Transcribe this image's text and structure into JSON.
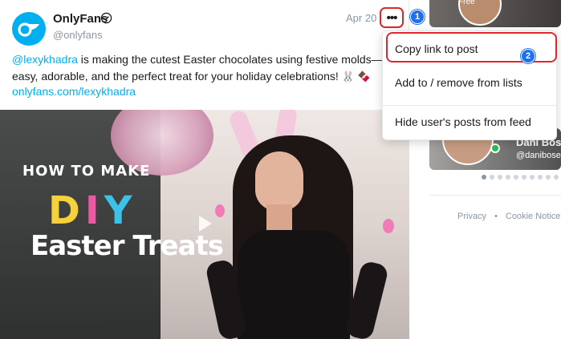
{
  "post": {
    "author_name": "OnlyFans",
    "handle": "@onlyfans",
    "date": "Apr 20",
    "more_label": "•••",
    "caption_mention": "@lexykhadra",
    "caption_text": " is making the cutest Easter chocolates using festive molds—easy, adorable, and the perfect treat for your holiday celebrations! ",
    "caption_emojis": "🐰 🍫",
    "link": "onlyfans.com/lexykhadra"
  },
  "media": {
    "title_line1": "HOW TO MAKE",
    "title_diy_d": "D",
    "title_diy_i": "I",
    "title_diy_y": "Y",
    "title_line3": "Easter Treats"
  },
  "annotations": {
    "step1": "1",
    "step2": "2"
  },
  "menu": {
    "items": [
      {
        "label": "Copy link to post"
      },
      {
        "label": "Add to / remove from lists"
      },
      {
        "label": "Hide user's posts from feed"
      }
    ]
  },
  "sidebar": {
    "card_top_badge": "Free",
    "card_bottom_name": "Dani Bos",
    "card_bottom_handle": "@danibose",
    "footer_privacy": "Privacy",
    "footer_sep": "•",
    "footer_cookie": "Cookie Notice"
  },
  "colors": {
    "brand": "#00aff0",
    "annotation_red": "#e0262b",
    "annotation_blue": "#1b6ff0",
    "online": "#27c24c"
  },
  "icons": [
    "onlyfans-logo-icon",
    "verified-icon",
    "more-icon",
    "play-icon"
  ]
}
